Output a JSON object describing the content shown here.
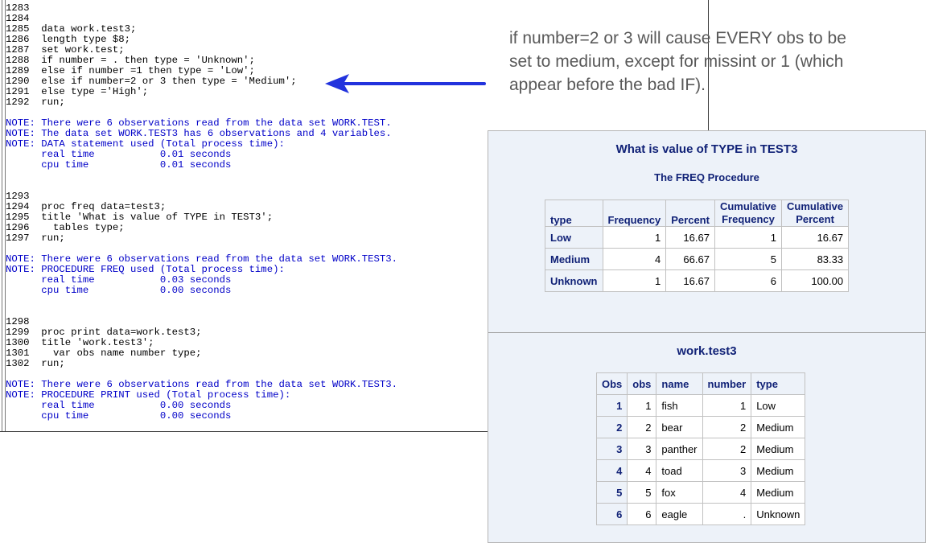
{
  "log": {
    "lines": [
      {
        "text": "1283",
        "note": false
      },
      {
        "text": "1284",
        "note": false
      },
      {
        "text": "1285  data work.test3;",
        "note": false
      },
      {
        "text": "1286  length type $8;",
        "note": false
      },
      {
        "text": "1287  set work.test;",
        "note": false
      },
      {
        "text": "1288  if number = . then type = 'Unknown';",
        "note": false
      },
      {
        "text": "1289  else if number =1 then type = 'Low';",
        "note": false
      },
      {
        "text": "1290  else if number=2 or 3 then type = 'Medium';",
        "note": false
      },
      {
        "text": "1291  else type ='High';",
        "note": false
      },
      {
        "text": "1292  run;",
        "note": false
      },
      {
        "text": "",
        "note": false
      },
      {
        "text": "NOTE: There were 6 observations read from the data set WORK.TEST.",
        "note": true
      },
      {
        "text": "NOTE: The data set WORK.TEST3 has 6 observations and 4 variables.",
        "note": true
      },
      {
        "text": "NOTE: DATA statement used (Total process time):",
        "note": true
      },
      {
        "text": "      real time           0.01 seconds",
        "note": true
      },
      {
        "text": "      cpu time            0.01 seconds",
        "note": true
      },
      {
        "text": "",
        "note": false
      },
      {
        "text": "",
        "note": false
      },
      {
        "text": "1293",
        "note": false
      },
      {
        "text": "1294  proc freq data=test3;",
        "note": false
      },
      {
        "text": "1295  title 'What is value of TYPE in TEST3';",
        "note": false
      },
      {
        "text": "1296    tables type;",
        "note": false
      },
      {
        "text": "1297  run;",
        "note": false
      },
      {
        "text": "",
        "note": false
      },
      {
        "text": "NOTE: There were 6 observations read from the data set WORK.TEST3.",
        "note": true
      },
      {
        "text": "NOTE: PROCEDURE FREQ used (Total process time):",
        "note": true
      },
      {
        "text": "      real time           0.03 seconds",
        "note": true
      },
      {
        "text": "      cpu time            0.00 seconds",
        "note": true
      },
      {
        "text": "",
        "note": false
      },
      {
        "text": "",
        "note": false
      },
      {
        "text": "1298",
        "note": false
      },
      {
        "text": "1299  proc print data=work.test3;",
        "note": false
      },
      {
        "text": "1300  title 'work.test3';",
        "note": false
      },
      {
        "text": "1301    var obs name number type;",
        "note": false
      },
      {
        "text": "1302  run;",
        "note": false
      },
      {
        "text": "",
        "note": false
      },
      {
        "text": "NOTE: There were 6 observations read from the data set WORK.TEST3.",
        "note": true
      },
      {
        "text": "NOTE: PROCEDURE PRINT used (Total process time):",
        "note": true
      },
      {
        "text": "      real time           0.00 seconds",
        "note": true
      },
      {
        "text": "      cpu time            0.00 seconds",
        "note": true
      }
    ]
  },
  "annotation": {
    "lines": [
      "if number=2 or 3 will cause EVERY obs to be",
      "set to medium, except for missint or 1 (which",
      "appear before the bad IF)."
    ]
  },
  "colors": {
    "note_text": "#0000c8",
    "arrow": "#2233dd",
    "results_bg": "#edf2f9",
    "header_text": "#112277"
  },
  "freq": {
    "title": "What is value of TYPE in TEST3",
    "subtitle": "The FREQ Procedure",
    "headers": {
      "type": "type",
      "frequency": "Frequency",
      "percent": "Percent",
      "cum_freq_1": "Cumulative",
      "cum_freq_2": "Frequency",
      "cum_pct_1": "Cumulative",
      "cum_pct_2": "Percent"
    },
    "rows": [
      {
        "type": "Low",
        "frequency": "1",
        "percent": "16.67",
        "cum_freq": "1",
        "cum_pct": "16.67"
      },
      {
        "type": "Medium",
        "frequency": "4",
        "percent": "66.67",
        "cum_freq": "5",
        "cum_pct": "83.33"
      },
      {
        "type": "Unknown",
        "frequency": "1",
        "percent": "16.67",
        "cum_freq": "6",
        "cum_pct": "100.00"
      }
    ]
  },
  "print": {
    "title": "work.test3",
    "headers": {
      "Obs": "Obs",
      "obs": "obs",
      "name": "name",
      "number": "number",
      "type": "type"
    },
    "rows": [
      {
        "Obs": "1",
        "obs": "1",
        "name": "fish",
        "number": "1",
        "type": "Low"
      },
      {
        "Obs": "2",
        "obs": "2",
        "name": "bear",
        "number": "2",
        "type": "Medium"
      },
      {
        "Obs": "3",
        "obs": "3",
        "name": "panther",
        "number": "2",
        "type": "Medium"
      },
      {
        "Obs": "4",
        "obs": "4",
        "name": "toad",
        "number": "3",
        "type": "Medium"
      },
      {
        "Obs": "5",
        "obs": "5",
        "name": "fox",
        "number": "4",
        "type": "Medium"
      },
      {
        "Obs": "6",
        "obs": "6",
        "name": "eagle",
        "number": ".",
        "type": "Unknown"
      }
    ]
  }
}
